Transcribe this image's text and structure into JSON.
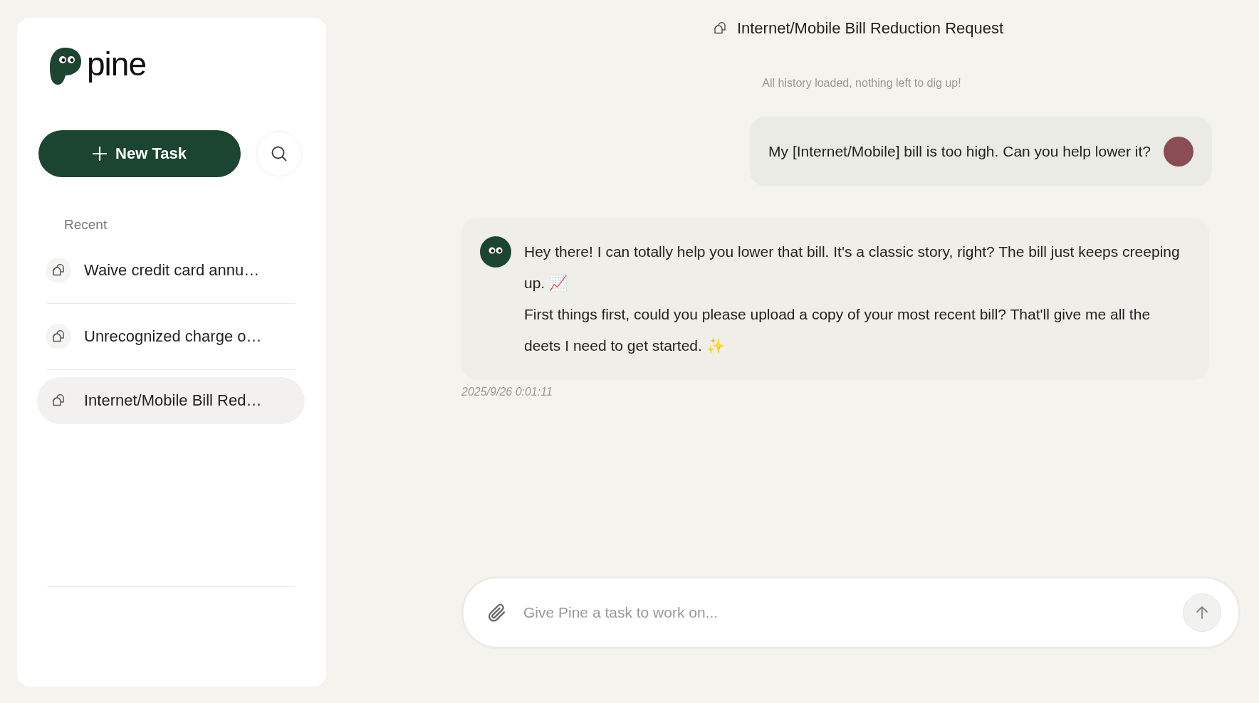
{
  "sidebar": {
    "logo": "pine",
    "new_task_button": "New Task",
    "recent_label": "Recent",
    "items": [
      {
        "label": "Waive credit card annu…",
        "selected": false
      },
      {
        "label": "Unrecognized charge o…",
        "selected": false
      },
      {
        "label": "Internet/Mobile Bill Red…",
        "selected": true
      }
    ]
  },
  "chat": {
    "title": "Internet/Mobile Bill Reduction Request",
    "history_note": "All history loaded, nothing left to dig up!",
    "messages": [
      {
        "kind": "user",
        "paragraphs": [
          "My [Internet/Mobile] bill is too high. Can you help lower it?"
        ]
      },
      {
        "kind": "assistant",
        "paragraphs": [
          "Hey there! I can totally help you lower that bill. It's a classic story, right? The bill just keeps creeping up. 📈",
          "First things first, could you please upload a copy of your most recent bill? That'll give me all the deets I need to get started. ✨"
        ],
        "timestamp": "2025/9/26 0:01:11"
      }
    ]
  },
  "composer": {
    "placeholder": "Give Pine a task to work on..."
  }
}
